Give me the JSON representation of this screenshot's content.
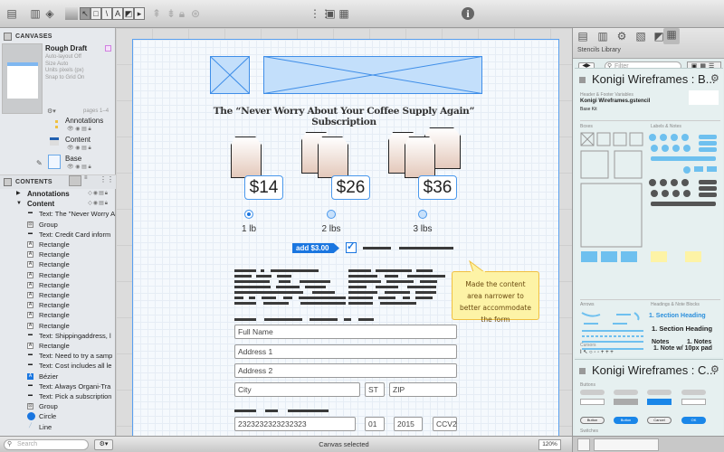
{
  "toolbar": {
    "icons": [
      "sidebar-toggle-icon",
      "canvases-icon",
      "layers-icon",
      "style-swatch-icon",
      "selection-tool-icon",
      "shape-tool-icon",
      "line-tool-icon",
      "text-tool-icon",
      "diagram-tool-icon",
      "more-tools-icon",
      "bring-front-icon",
      "send-back-icon",
      "lock-icon",
      "group-icon",
      "grid-icon",
      "stencils-icon",
      "inspector-icon",
      "info-icon"
    ]
  },
  "sidebar": {
    "canvases_header": "CANVASES",
    "canvas": {
      "name": "Rough Draft",
      "props": [
        "Auto-layout Off",
        "Size Auto",
        "Units pixels (px)",
        "Snap to Grid On"
      ],
      "pages": "pages 1–4"
    },
    "layers": [
      {
        "name": "Annotations"
      },
      {
        "name": "Content"
      },
      {
        "name": "Base"
      }
    ],
    "contents_header": "CONTENTS",
    "tree": [
      {
        "label": "Annotations",
        "level": 0,
        "expanded": false
      },
      {
        "label": "Content",
        "level": 0,
        "expanded": true
      },
      {
        "label": "Text: The \"Never Worry A",
        "icon": "text"
      },
      {
        "label": "Group",
        "icon": "group"
      },
      {
        "label": "Text: Credit Card inform",
        "icon": "text"
      },
      {
        "label": "Rectangle",
        "icon": "rect"
      },
      {
        "label": "Rectangle",
        "icon": "rect"
      },
      {
        "label": "Rectangle",
        "icon": "rect"
      },
      {
        "label": "Rectangle",
        "icon": "rect"
      },
      {
        "label": "Rectangle",
        "icon": "rect"
      },
      {
        "label": "Rectangle",
        "icon": "rect"
      },
      {
        "label": "Rectangle",
        "icon": "rect"
      },
      {
        "label": "Rectangle",
        "icon": "rect"
      },
      {
        "label": "Rectangle",
        "icon": "rect"
      },
      {
        "label": "Text: Shippingaddress, l",
        "icon": "text"
      },
      {
        "label": "Rectangle",
        "icon": "rect"
      },
      {
        "label": "Text: Need to try a samp",
        "icon": "text"
      },
      {
        "label": "Text: Cost includes all le",
        "icon": "text"
      },
      {
        "label": "Bézier",
        "icon": "bezier"
      },
      {
        "label": "Text: Always Organi-Tra",
        "icon": "text"
      },
      {
        "label": "Text: Pick a subscription",
        "icon": "text"
      },
      {
        "label": "Group",
        "icon": "group"
      },
      {
        "label": "Circle",
        "icon": "circle"
      },
      {
        "label": "Line",
        "icon": "line"
      }
    ],
    "search_placeholder": "Search"
  },
  "canvas": {
    "title": "The “Never Worry About Your Coffee Supply Again” Subscription",
    "options": [
      {
        "price": "$14",
        "label": "1 lb",
        "selected": true
      },
      {
        "price": "$26",
        "label": "2 lbs",
        "selected": false
      },
      {
        "price": "$36",
        "label": "3 lbs",
        "selected": false
      }
    ],
    "addon_tag": "add $3.00",
    "addon_checked": true,
    "note": "Made the content area narrower to better accommodate the form",
    "fields": {
      "full_name": "Full Name",
      "address1": "Address 1",
      "address2": "Address 2",
      "city": "City",
      "state": "ST",
      "zip": "ZIP",
      "card": "2323232323232323",
      "month": "01",
      "year": "2015",
      "cvv": "CCV2"
    }
  },
  "status": {
    "text": "Canvas selected",
    "zoom": "120%"
  },
  "stencils": {
    "title": "Stencils Library",
    "filter_placeholder": "Filter",
    "panels": [
      {
        "title": "Konigi Wireframes : B...",
        "sections": [
          "Header & Footer Variables",
          "Boxes",
          "Labels & Notes",
          "Arrows",
          "Headings & Note Blocks",
          "Cursors"
        ],
        "file": "Konigi Wireframes.gstencil",
        "kit": "Base Kit",
        "headings": [
          "1. Section Heading",
          "1. Section Heading",
          "Notes",
          "1. Notes",
          "1. Note w/ 10px pad"
        ]
      },
      {
        "title": "Konigi Wireframes : C...",
        "sections": [
          "Buttons",
          "Switches"
        ],
        "buttons": [
          "Button",
          "Button",
          "Cancel",
          "OK"
        ]
      }
    ]
  },
  "colors": {
    "accent": "#1a76e0",
    "placeholder_fill": "#c3dffb",
    "note_fill": "#fdf3a6"
  }
}
